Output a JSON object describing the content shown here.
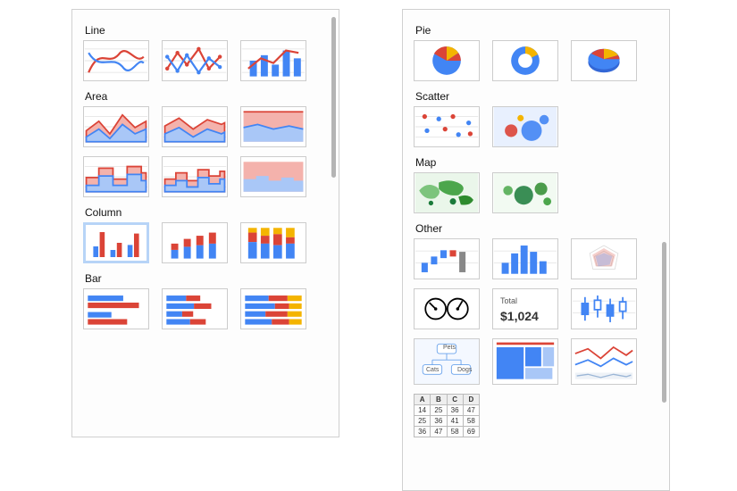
{
  "colors": {
    "blue": "#4285f4",
    "red": "#db4437",
    "orange": "#f4b400",
    "green": "#0f9d58",
    "lightblue": "#a9c7f7",
    "lightred": "#f4b2ac",
    "grid": "#e6e6e6",
    "darkgreen": "#1a7a3a"
  },
  "left": {
    "sections": {
      "line": "Line",
      "area": "Area",
      "column": "Column",
      "bar": "Bar"
    }
  },
  "right": {
    "sections": {
      "pie": "Pie",
      "scatter": "Scatter",
      "map": "Map",
      "other": "Other"
    },
    "scorecard": {
      "label": "Total",
      "value": "$1,024"
    },
    "orgchart": {
      "pets": "Pets",
      "cats": "Cats",
      "dogs": "Dogs"
    },
    "sheet": {
      "headers": [
        "A",
        "B",
        "C",
        "D"
      ],
      "rows": [
        [
          "14",
          "25",
          "36",
          "47"
        ],
        [
          "25",
          "36",
          "41",
          "58"
        ],
        [
          "36",
          "47",
          "58",
          "69"
        ]
      ]
    }
  }
}
